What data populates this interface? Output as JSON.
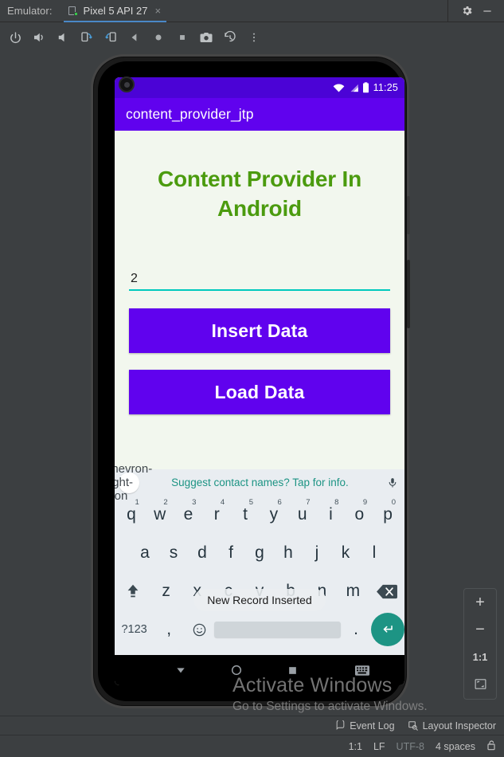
{
  "window": {
    "label": "Emulator:",
    "tab": {
      "name": "Pixel 5 API 27",
      "close": "×",
      "icon": "device-icon"
    },
    "controls": {
      "settings": "gear-icon",
      "minimize": "minimize-icon"
    }
  },
  "emulator_toolbar": {
    "buttons": [
      {
        "name": "power-button",
        "icon": "power-icon"
      },
      {
        "name": "volume-up-button",
        "icon": "volume-up-icon"
      },
      {
        "name": "volume-down-button",
        "icon": "volume-down-icon"
      },
      {
        "name": "rotate-left-button",
        "icon": "rotate-left-icon"
      },
      {
        "name": "rotate-right-button",
        "icon": "rotate-right-icon"
      },
      {
        "name": "back-button",
        "icon": "triangle-back-icon"
      },
      {
        "name": "home-button",
        "icon": "circle-home-icon"
      },
      {
        "name": "overview-button",
        "icon": "square-overview-icon"
      },
      {
        "name": "screenshot-button",
        "icon": "camera-icon"
      },
      {
        "name": "record-history-button",
        "icon": "history-icon"
      },
      {
        "name": "more-button",
        "icon": "vertical-dots-icon"
      }
    ]
  },
  "phone": {
    "status_bar": {
      "time": "11:25",
      "icons": [
        "wifi-icon",
        "signal-icon",
        "battery-icon"
      ]
    },
    "app_bar": {
      "title": "content_provider_jtp"
    },
    "app": {
      "heading": "Content Provider In Android",
      "input": {
        "value": "2",
        "placeholder": ""
      },
      "insert_button": "Insert Data",
      "load_button": "Load Data",
      "toast": "New Record Inserted"
    },
    "keyboard": {
      "suggestion": "Suggest contact names? Tap for info.",
      "expand_icon": "chevron-right-icon",
      "mic_icon": "microphone-icon",
      "row1": [
        {
          "ch": "q",
          "num": "1"
        },
        {
          "ch": "w",
          "num": "2"
        },
        {
          "ch": "e",
          "num": "3"
        },
        {
          "ch": "r",
          "num": "4"
        },
        {
          "ch": "t",
          "num": "5"
        },
        {
          "ch": "y",
          "num": "6"
        },
        {
          "ch": "u",
          "num": "7"
        },
        {
          "ch": "i",
          "num": "8"
        },
        {
          "ch": "o",
          "num": "9"
        },
        {
          "ch": "p",
          "num": "0"
        }
      ],
      "row2": [
        "a",
        "s",
        "d",
        "f",
        "g",
        "h",
        "j",
        "k",
        "l"
      ],
      "row3": [
        "z",
        "x",
        "c",
        "v",
        "b",
        "n",
        "m"
      ],
      "shift_icon": "shift-icon",
      "backspace_icon": "backspace-icon",
      "sym_key": "?123",
      "comma_key": ",",
      "emoji_icon": "emoji-icon",
      "period_key": ".",
      "enter_icon": "enter-icon"
    },
    "nav_bar": {
      "back": "triangle-down-icon",
      "home": "circle-icon",
      "recents": "square-icon",
      "keyboard": "keyboard-icon"
    }
  },
  "zoom_panel": {
    "zoom_in": "+",
    "zoom_out": "−",
    "actual_size": "1:1",
    "fit_icon": "fit-screen-icon"
  },
  "watermark": {
    "line1": "Activate Windows",
    "line2": "Go to Settings to activate Windows."
  },
  "bottom_bar": {
    "event_log": "Event Log",
    "layout_inspector": "Layout Inspector",
    "event_log_icon": "event-log-icon",
    "layout_inspector_icon": "layout-inspector-icon"
  },
  "status_bar": {
    "caret": "1:1",
    "line_separator": "LF",
    "encoding": "UTF-8",
    "indent": "4 spaces",
    "lock_icon": "lock-icon"
  },
  "colors": {
    "ide_bg": "#3c3f41",
    "app_bar_purple": "#6002ee",
    "status_purple": "#4b03d6",
    "heading_green": "#4b9b0e",
    "accent_teal": "#00c9bd",
    "suggest_teal": "#1d9484",
    "app_bg": "#f2f7ee",
    "keyboard_bg": "#e9edf1",
    "tab_underline": "#4a88c7"
  }
}
